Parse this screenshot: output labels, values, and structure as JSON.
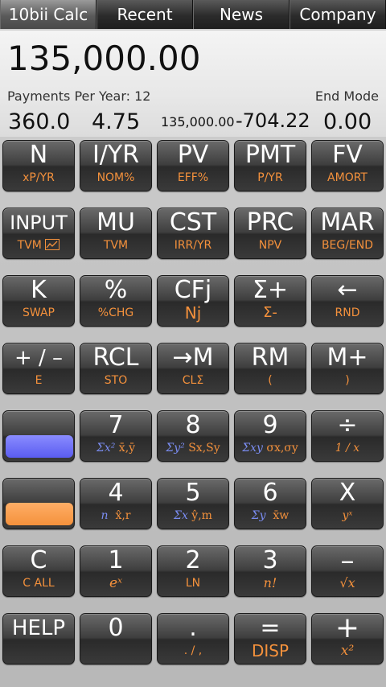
{
  "tabs": [
    "10bii Calc",
    "Recent",
    "News",
    "Company"
  ],
  "display": {
    "main_value": "135,000.00",
    "payments_per_year": "Payments Per Year: 12",
    "mode": "End Mode",
    "registers": [
      "360.0",
      "4.75",
      "135,000.00",
      "-704.22",
      "0.00"
    ]
  },
  "keys": {
    "r0": [
      {
        "main": "N",
        "sub": "xP/YR"
      },
      {
        "main": "I/YR",
        "sub": "NOM%"
      },
      {
        "main": "PV",
        "sub": "EFF%"
      },
      {
        "main": "PMT",
        "sub": "P/YR"
      },
      {
        "main": "FV",
        "sub": "AMORT"
      }
    ],
    "r1": [
      {
        "main": "INPUT",
        "sub": "TVM"
      },
      {
        "main": "MU",
        "sub": "TVM"
      },
      {
        "main": "CST",
        "sub": "IRR/YR"
      },
      {
        "main": "PRC",
        "sub": "NPV"
      },
      {
        "main": "MAR",
        "sub": "BEG/END"
      }
    ],
    "r2": [
      {
        "main": "K",
        "sub": "SWAP"
      },
      {
        "main": "%",
        "sub": "%CHG"
      },
      {
        "main": "CFj",
        "sub": "Nj"
      },
      {
        "main": "Σ+",
        "sub": "Σ-"
      },
      {
        "main": "←",
        "sub": "RND"
      }
    ],
    "r3": [
      {
        "main": "+ / –",
        "sub": "E"
      },
      {
        "main": "RCL",
        "sub": "STO"
      },
      {
        "main": "→M",
        "sub": "CLΣ"
      },
      {
        "main": "RM",
        "sub": "("
      },
      {
        "main": "M+",
        "sub": ")"
      }
    ],
    "r4": [
      {
        "main": "",
        "sub": ""
      },
      {
        "main": "7",
        "blue": "Σx²",
        "orange": "x̄,ȳ"
      },
      {
        "main": "8",
        "blue": "Σy²",
        "orange": "Sx,Sy"
      },
      {
        "main": "9",
        "blue": "Σxy",
        "orange": "σx,σy"
      },
      {
        "main": "÷",
        "sub": "1 / x"
      }
    ],
    "r5": [
      {
        "main": "",
        "sub": ""
      },
      {
        "main": "4",
        "blue": "n",
        "orange": "x̂,r"
      },
      {
        "main": "5",
        "blue": "Σx",
        "orange": "ŷ,m"
      },
      {
        "main": "6",
        "blue": "Σy",
        "orange": "x̄w"
      },
      {
        "main": "X",
        "sub": "yˣ"
      }
    ],
    "r6": [
      {
        "main": "C",
        "sub": "C ALL"
      },
      {
        "main": "1",
        "sub": "eˣ"
      },
      {
        "main": "2",
        "sub": "LN"
      },
      {
        "main": "3",
        "sub": "n!"
      },
      {
        "main": "–",
        "sub": "√x"
      }
    ],
    "r7": [
      {
        "main": "HELP",
        "sub": ""
      },
      {
        "main": "0",
        "sub": ""
      },
      {
        "main": ".",
        "sub": ". / ,"
      },
      {
        "main": "=",
        "sub": "DISP"
      },
      {
        "main": "+",
        "sub": "x²"
      }
    ]
  },
  "colors": {
    "shift_blue": "#6a6cf8",
    "shift_orange": "#f4913c",
    "sub_label": "#f4913c",
    "blue_label": "#7a8cf0"
  }
}
